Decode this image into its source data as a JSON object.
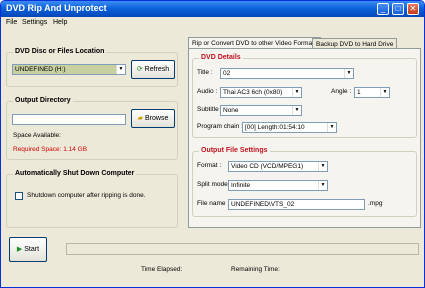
{
  "window": {
    "title": "DVD Rip And Unprotect"
  },
  "menu": [
    "File",
    "Settings",
    "Help"
  ],
  "source": {
    "group_title": "DVD Disc or Files Location",
    "drive": "UNDEFINED (H:)",
    "refresh": "Refresh"
  },
  "output_dir": {
    "group_title": "Output Directory",
    "path": "",
    "browse": "Browse",
    "space_available": "Space Available:",
    "required_space": "Required Space: 1.14 GB"
  },
  "shutdown": {
    "group_title": "Automatically Shut Down Computer",
    "checkbox_label": "Shutdown computer after ripping is done."
  },
  "tabs": [
    "Rip or Convert DVD to other Video Formats",
    "Backup DVD to Hard Drive"
  ],
  "dvd_details": {
    "group_title": "DVD Details",
    "title_label": "Title :",
    "title_value": "02",
    "audio_label": "Audio :",
    "audio_value": "Thai AC3 6ch (0x80)",
    "angle_label": "Angle :",
    "angle_value": "1",
    "subtitle_label": "Subtitle :",
    "subtitle_value": "None",
    "chain_label": "Program chain :",
    "chain_value": "[00] Length:01:54:10"
  },
  "output_settings": {
    "group_title": "Output File Settings",
    "format_label": "Format :",
    "format_value": "Video CD (VCD/MPEG1)",
    "split_label": "Split mode :",
    "split_value": "Infinite",
    "filename_label": "File name :",
    "filename_value": "UNDEFINED\\VTS_02",
    "ext": ".mpg"
  },
  "bottom": {
    "start": "Start",
    "time_elapsed": "Time Elapsed:",
    "remaining_time": "Remaining Time:"
  }
}
